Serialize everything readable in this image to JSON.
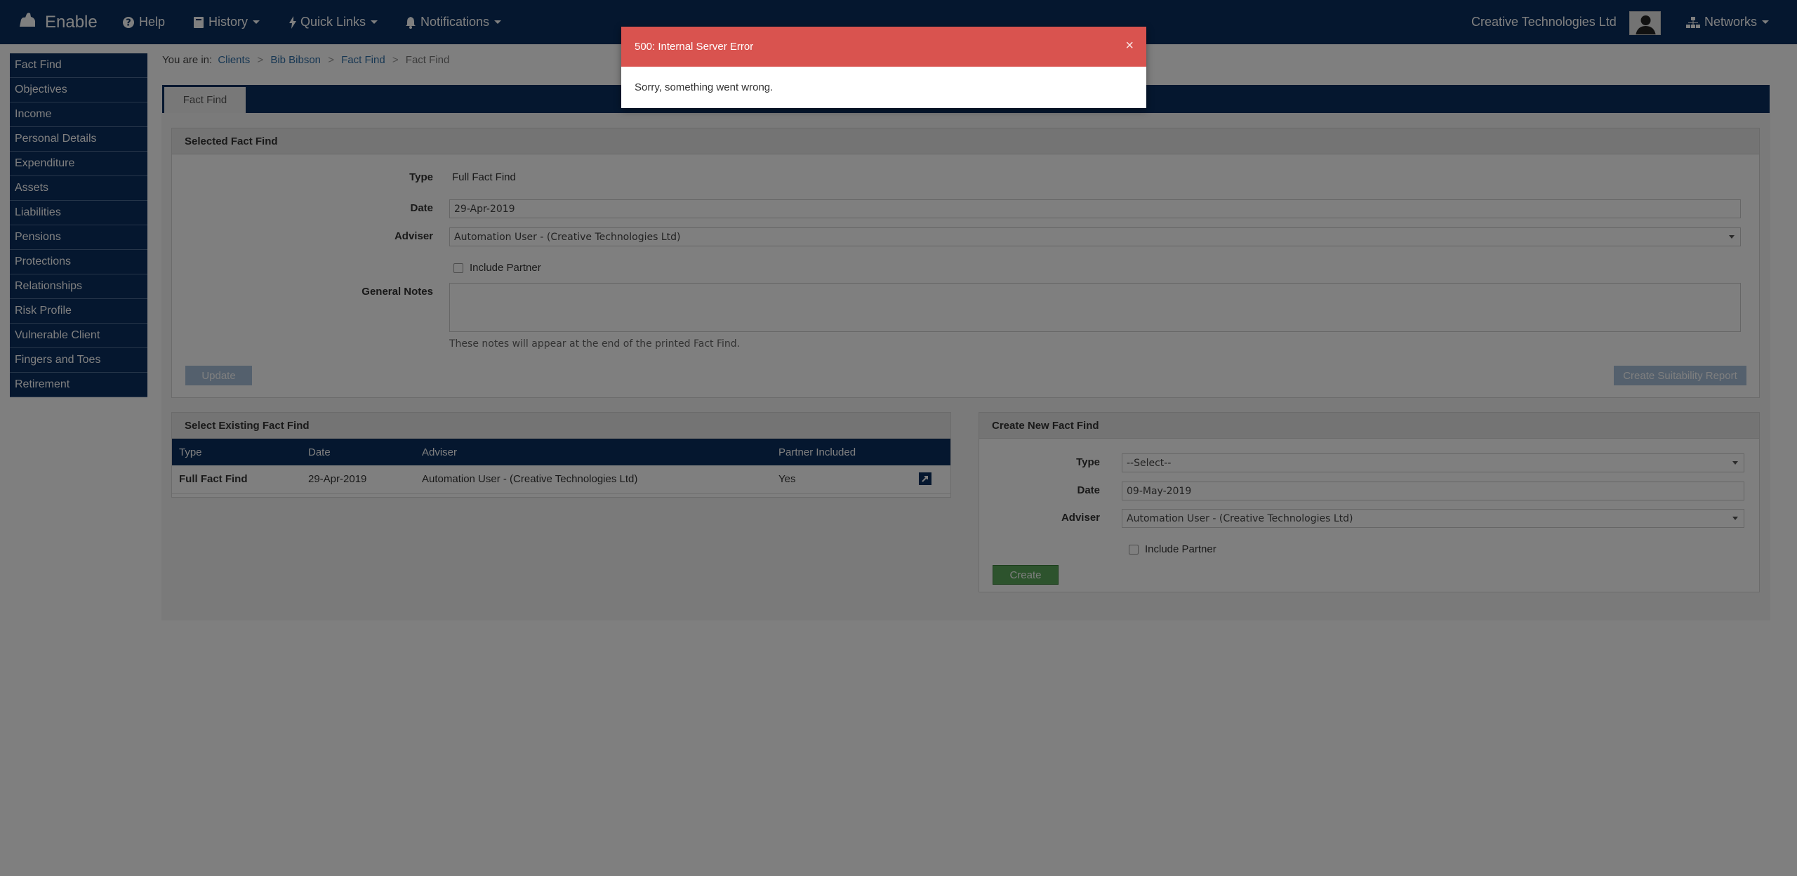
{
  "navbar": {
    "brand": "Enable",
    "help": "Help",
    "history": "History",
    "quick_links": "Quick Links",
    "notifications": "Notifications",
    "company": "Creative Technologies Ltd",
    "networks": "Networks"
  },
  "sidebar": {
    "items": [
      {
        "label": "Fact Find"
      },
      {
        "label": "Objectives"
      },
      {
        "label": "Income"
      },
      {
        "label": "Personal Details"
      },
      {
        "label": "Expenditure"
      },
      {
        "label": "Assets"
      },
      {
        "label": "Liabilities"
      },
      {
        "label": "Pensions"
      },
      {
        "label": "Protections"
      },
      {
        "label": "Relationships"
      },
      {
        "label": "Risk Profile"
      },
      {
        "label": "Vulnerable Client"
      },
      {
        "label": "Fingers and Toes"
      },
      {
        "label": "Retirement"
      }
    ]
  },
  "breadcrumb": {
    "prefix": "You are in:",
    "items": [
      "Clients",
      "Bib Bibson",
      "Fact Find"
    ],
    "current": "Fact Find",
    "sep": ">"
  },
  "tabs": [
    {
      "label": "Fact Find"
    }
  ],
  "selected": {
    "title": "Selected Fact Find",
    "type_label": "Type",
    "type_value": "Full Fact Find",
    "date_label": "Date",
    "date_value": "29-Apr-2019",
    "adviser_label": "Adviser",
    "adviser_value": "Automation User - (Creative Technologies Ltd)",
    "include_partner": "Include Partner",
    "notes_label": "General Notes",
    "notes_help": "These notes will appear at the end of the printed Fact Find.",
    "update_btn": "Update",
    "suitability_btn": "Create Suitability Report"
  },
  "existing": {
    "title": "Select Existing Fact Find",
    "columns": [
      "Type",
      "Date",
      "Adviser",
      "Partner Included"
    ],
    "rows": [
      {
        "type": "Full Fact Find",
        "date": "29-Apr-2019",
        "adviser": "Automation User - (Creative Technologies Ltd)",
        "partner": "Yes"
      }
    ]
  },
  "create": {
    "title": "Create New Fact Find",
    "type_label": "Type",
    "type_value": "--Select--",
    "date_label": "Date",
    "date_value": "09-May-2019",
    "adviser_label": "Adviser",
    "adviser_value": "Automation User - (Creative Technologies Ltd)",
    "include_partner": "Include Partner",
    "create_btn": "Create"
  },
  "modal": {
    "title": "500: Internal Server Error",
    "close": "×",
    "message": "Sorry, something went wrong."
  },
  "colors": {
    "navy": "#0a2f5f",
    "error_red": "#d9534f",
    "success_green": "#5aa65a",
    "primary_btn": "#a8c0da"
  }
}
